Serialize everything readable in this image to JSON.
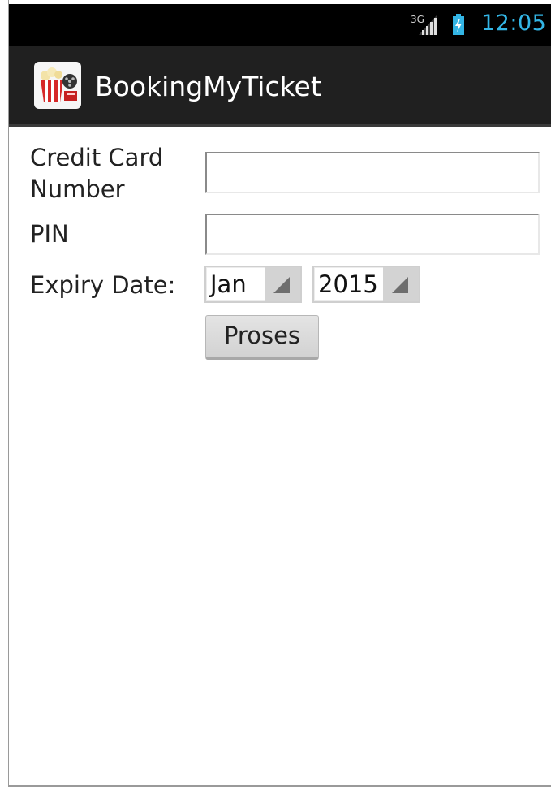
{
  "status_bar": {
    "network_type": "3G",
    "signal_icon": "signal-bars-icon",
    "battery_icon": "battery-charging-icon",
    "time": "12:05",
    "time_color": "#33b5e5"
  },
  "action_bar": {
    "app_icon": "popcorn-film-icon",
    "title": "BookingMyTicket",
    "background": "#202020"
  },
  "form": {
    "credit_card": {
      "label_line1": "Credit Card",
      "label_line2": "Number",
      "value": "",
      "placeholder": ""
    },
    "pin": {
      "label": "PIN",
      "value": "",
      "placeholder": ""
    },
    "expiry": {
      "label": "Expiry Date:",
      "month": "Jan",
      "year": "2015",
      "dropdown_icon": "spinner-triangle-icon"
    },
    "submit_label": "Proses"
  }
}
